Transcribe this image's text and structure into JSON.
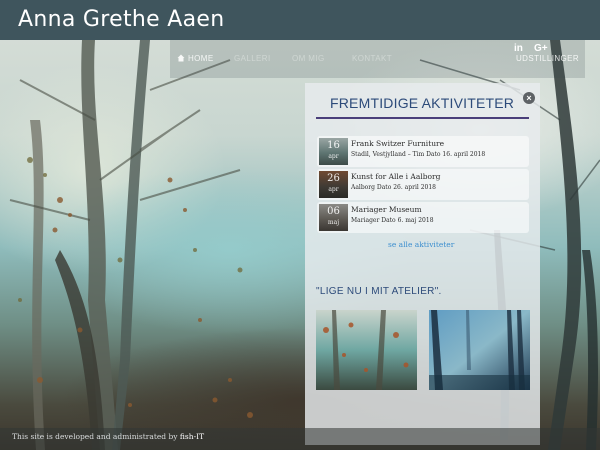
{
  "site": {
    "title": "Anna Grethe Aaen"
  },
  "nav": {
    "items": [
      {
        "label": "HOME"
      },
      {
        "label": "GALLERI"
      },
      {
        "label": "OM MIG"
      },
      {
        "label": "KONTAKT"
      },
      {
        "label": "UDSTILLINGER"
      }
    ]
  },
  "social": {
    "linkedin": "in",
    "googleplus": "G+"
  },
  "panel": {
    "title": "FREMTIDIGE AKTIVITETER",
    "close_symbol": "×",
    "events": [
      {
        "day": "16",
        "month": "apr",
        "name": "Frank Switzer Furniture",
        "detail": "Stadil, Vestjylland – Tim Dato 16. april 2018"
      },
      {
        "day": "26",
        "month": "apr",
        "name": "Kunst for Alle i Aalborg",
        "detail": "Aalborg Dato 26. april 2018"
      },
      {
        "day": "06",
        "month": "maj",
        "name": "Mariager Museum",
        "detail": "Mariager Dato 6. maj 2018"
      }
    ],
    "see_all": "se alle aktiviteter",
    "atelier_title": "\"LIGE NU I MIT ATELIER\"."
  },
  "footer": {
    "text": "This site is developed and administrated by ",
    "link": "fish-IT"
  },
  "colors": {
    "header_bg": "#3f555d",
    "panel_title": "#2d4b7a",
    "link": "#3d8fcf",
    "rule": "#4a3f7a"
  },
  "icons": {
    "home": "home-icon",
    "close": "close-icon"
  }
}
